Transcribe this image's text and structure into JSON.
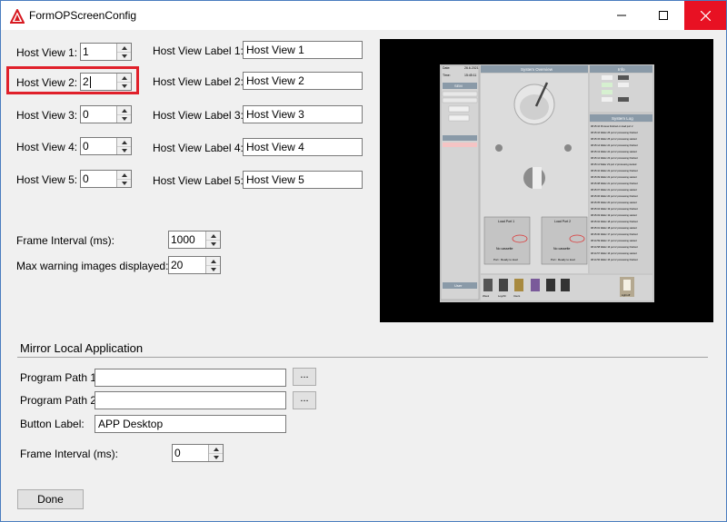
{
  "window": {
    "title": "FormOPScreenConfig",
    "accent_color": "#e81123"
  },
  "host_views": [
    {
      "label": "Host View 1:",
      "value": "1",
      "label_caption": "Host View Label 1:",
      "label_value": "Host View 1"
    },
    {
      "label": "Host View 2:",
      "value": "2",
      "label_caption": "Host View Label 2:",
      "label_value": "Host View 2"
    },
    {
      "label": "Host View 3:",
      "value": "0",
      "label_caption": "Host View Label 3:",
      "label_value": "Host View 3"
    },
    {
      "label": "Host View 4:",
      "value": "0",
      "label_caption": "Host View Label 4:",
      "label_value": "Host View 4"
    },
    {
      "label": "Host View 5:",
      "value": "0",
      "label_caption": "Host View Label 5:",
      "label_value": "Host View 5"
    }
  ],
  "frame_interval": {
    "label": "Frame Interval (ms):",
    "value": "1000"
  },
  "max_warning": {
    "label": "Max warning images displayed:",
    "value": "20"
  },
  "mirror": {
    "title": "Mirror Local Application",
    "program_path_1": {
      "label": "Program Path 1:",
      "value": "",
      "browse": "..."
    },
    "program_path_2": {
      "label": "Program Path 2:",
      "value": "",
      "browse": "..."
    },
    "button_label": {
      "label": "Button Label:",
      "value": "APP Desktop"
    },
    "frame_interval": {
      "label": "Frame Interval (ms):",
      "value": "0"
    }
  },
  "done_label": "Done",
  "preview": {
    "date_label": "Date:",
    "date_value": "26.6.2021",
    "time_label": "Time:",
    "time_value": "15:45:11",
    "system_overview": "System Overview",
    "info": "Info",
    "sem": "SEM",
    "system_log": "System Log",
    "load_port_1": "Load Port 1",
    "load_port_2": "Load Port 2",
    "no_cassette": "No cassette",
    "port_ready": "Port : Ready to load",
    "user": "User",
    "log_entries": [
      "08:15:16 Process finished on load port 2",
      "08:15:16 Wafer 25 port 2 processing finished",
      "08:15:15 Wafer 25 port 2 processing started",
      "08:15:14 Wafer 24 port 2 processing finished",
      "08:15:13 Wafer 24 port 2 processing started",
      "08:15:12 Wafer 23 port 2 processing finished",
      "08:15:11 Wafer 23 port 2 processing started",
      "08:15:10 Wafer 22 port 2 processing finished",
      "08:15:09 Wafer 22 port 2 processing started",
      "08:15:08 Wafer 21 port 2 processing finished",
      "08:15:07 Wafer 21 port 2 processing started",
      "08:15:06 Wafer 20 port 2 processing finished",
      "08:15:05 Wafer 20 port 2 processing started",
      "08:15:04 Wafer 19 port 2 processing finished",
      "08:15:03 Wafer 19 port 2 processing started",
      "08:15:02 Wafer 18 port 2 processing finished",
      "08:15:01 Wafer 18 port 2 processing started",
      "08:15:00 Wafer 17 port 2 processing finished",
      "08:14:59 Wafer 17 port 2 processing started",
      "08:14:58 Wafer 16 port 2 processing finished",
      "08:14:57 Wafer 16 port 2 processing started",
      "08:14:56 Wafer 15 port 2 processing finished"
    ],
    "nav_items": [
      "Week",
      "Log/Alr",
      "Users"
    ],
    "light_label": "Light off"
  }
}
